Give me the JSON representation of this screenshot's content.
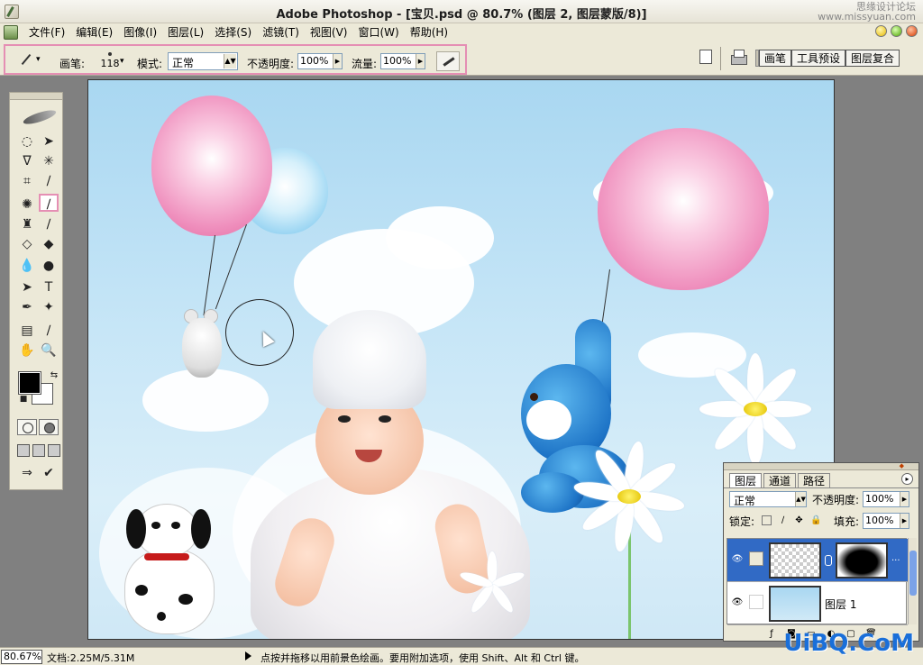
{
  "titlebar": {
    "title": "Adobe Photoshop - [宝贝.psd @ 80.7% (图层 2, 图层蒙版/8)]",
    "watermark_line1": "思缘设计论坛",
    "watermark_line2": "www.missyuan.com"
  },
  "menubar": {
    "items": [
      "文件(F)",
      "编辑(E)",
      "图像(I)",
      "图层(L)",
      "选择(S)",
      "滤镜(T)",
      "视图(V)",
      "窗口(W)",
      "帮助(H)"
    ]
  },
  "options": {
    "brush_label": "画笔:",
    "brush_size": "118",
    "mode_label": "模式:",
    "mode_value": "正常",
    "opacity_label": "不透明度:",
    "opacity_value": "100%",
    "flow_label": "流量:",
    "flow_value": "100%",
    "well_tabs": [
      "画笔",
      "工具预设",
      "图层复合"
    ]
  },
  "toolbox": {
    "tools": [
      "marquee-icon",
      "move-icon",
      "lasso-icon",
      "magic-wand-icon",
      "crop-icon",
      "slice-icon",
      "healing-icon",
      "brush-icon",
      "stamp-icon",
      "history-brush-icon",
      "eraser-icon",
      "bucket-icon",
      "blur-icon",
      "dodge-icon",
      "path-select-icon",
      "type-icon",
      "pen-icon",
      "shape-icon",
      "notes-icon",
      "eyedropper-icon",
      "hand-icon",
      "zoom-icon"
    ],
    "selected_tool": "brush-icon",
    "foreground_color": "#000000",
    "background_color": "#ffffff"
  },
  "layers_panel": {
    "tabs": [
      "图层",
      "通道",
      "路径"
    ],
    "active_tab": "图层",
    "blend_mode": "正常",
    "opacity_label": "不透明度:",
    "opacity_value": "100%",
    "lock_label": "锁定:",
    "fill_label": "填充:",
    "fill_value": "100%",
    "layers": [
      {
        "name": "",
        "selected": true,
        "has_mask": true
      },
      {
        "name": "图层 1",
        "selected": false,
        "has_mask": false
      }
    ]
  },
  "statusbar": {
    "zoom": "80.67%",
    "doc_info": "文档:2.25M/5.31M",
    "hint": "点按并拖移以用前景色绘画。要用附加选项，使用 Shift、Alt 和 Ctrl 键。",
    "watermark": "UiBQ.CoM"
  },
  "colors": {
    "highlight_pink": "#e58fb4",
    "selection_blue": "#316ac5",
    "chrome": "#ece9d8"
  }
}
